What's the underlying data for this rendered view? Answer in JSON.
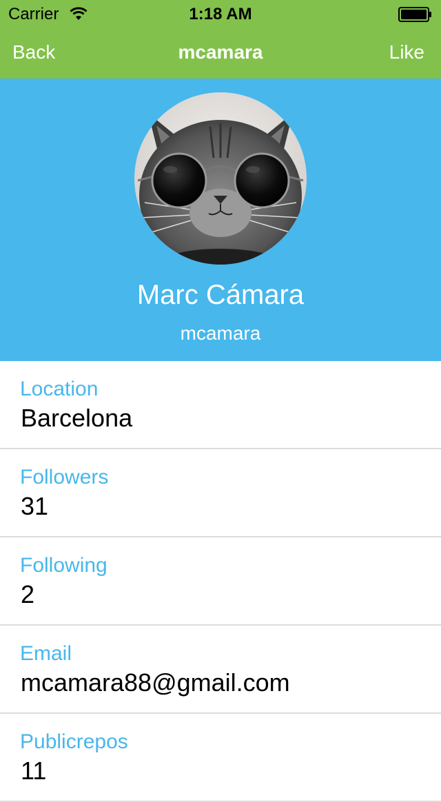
{
  "status_bar": {
    "carrier": "Carrier",
    "time": "1:18 AM"
  },
  "nav": {
    "back_label": "Back",
    "title": "mcamara",
    "like_label": "Like"
  },
  "profile": {
    "full_name": "Marc Cámara",
    "username": "mcamara"
  },
  "details": [
    {
      "label": "Location",
      "value": "Barcelona"
    },
    {
      "label": "Followers",
      "value": "31"
    },
    {
      "label": "Following",
      "value": "2"
    },
    {
      "label": "Email",
      "value": "mcamara88@gmail.com"
    },
    {
      "label": "Publicrepos",
      "value": "11"
    }
  ],
  "colors": {
    "nav_bar": "#82c14b",
    "header": "#47b7ec",
    "label": "#47b7ec",
    "divider": "#dcdcdc"
  },
  "icons": {
    "wifi": "wifi-icon",
    "battery": "battery-icon",
    "avatar": "cat-with-sunglasses-avatar"
  }
}
